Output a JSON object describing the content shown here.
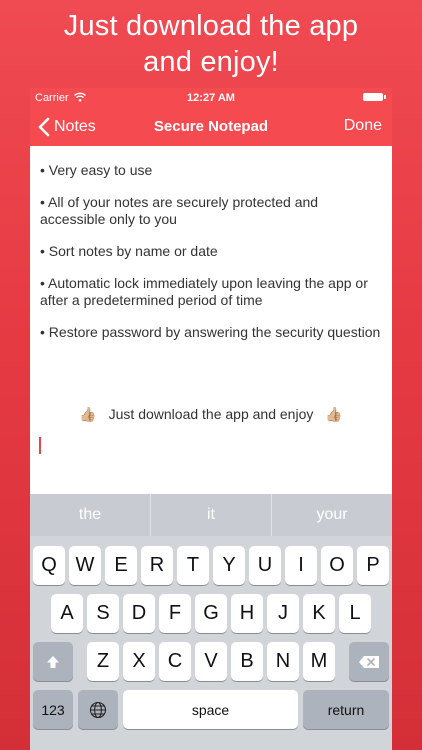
{
  "promo": {
    "line1": "Just download the app",
    "line2": "and enjoy!"
  },
  "status": {
    "carrier": "Carrier",
    "time": "12:27 AM"
  },
  "nav": {
    "back_label": "Notes",
    "title": "Secure Notepad",
    "done_label": "Done"
  },
  "note": {
    "bullets": [
      "• Very easy to use",
      "• All of your notes are securely protected and accessible only to you",
      "• Sort notes by name or date",
      "• Automatic lock immediately upon leaving the app or after a predetermined period of time",
      "• Restore password by answering the security question"
    ],
    "footer_text": "Just download the app and enjoy",
    "thumb": "👍🏼"
  },
  "suggestions": [
    "the",
    "it",
    "your"
  ],
  "keyboard": {
    "row1": [
      "Q",
      "W",
      "E",
      "R",
      "T",
      "Y",
      "U",
      "I",
      "O",
      "P"
    ],
    "row2": [
      "A",
      "S",
      "D",
      "F",
      "G",
      "H",
      "J",
      "K",
      "L"
    ],
    "row3": [
      "Z",
      "X",
      "C",
      "V",
      "B",
      "N",
      "M"
    ],
    "numbers_label": "123",
    "space_label": "space",
    "return_label": "return"
  },
  "colors": {
    "accent": "#f54a4f",
    "background": "#e63a43"
  }
}
